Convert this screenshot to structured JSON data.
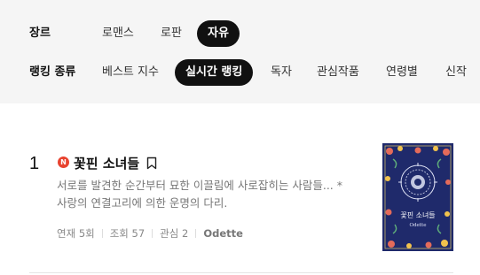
{
  "filters": {
    "genre_label": "장르",
    "genre_options": [
      {
        "label": "로맨스",
        "active": false
      },
      {
        "label": "로판",
        "active": false
      },
      {
        "label": "자유",
        "active": true
      }
    ],
    "ranking_label": "랭킹 종류",
    "ranking_options": [
      {
        "label": "베스트 지수",
        "active": false
      },
      {
        "label": "실시간 랭킹",
        "active": true
      },
      {
        "label": "독자",
        "active": false
      },
      {
        "label": "관심작품",
        "active": false
      },
      {
        "label": "연령별",
        "active": false
      },
      {
        "label": "신작",
        "active": false
      }
    ]
  },
  "entries": [
    {
      "rank": "1",
      "badge": "N",
      "title": "꽃핀 소녀들",
      "description_line1": "서로를 발견한 순간부터 묘한 이끌림에 사로잡히는 사람들... *",
      "description_line2": "사랑의 연결고리에 의한 운명의 다리.",
      "meta": {
        "serial": "연재 5회",
        "views": "조회 57",
        "interest": "관심 2",
        "author": "Odette"
      },
      "cover_title": "꽃핀 소녀들",
      "cover_author": "Odette"
    }
  ],
  "colors": {
    "active_chip": "#111111",
    "badge": "#e8432f",
    "cover_bg": "#1f2a6b"
  },
  "icons": {
    "badge": "new-badge-icon",
    "bookmark": "bookmark-icon"
  }
}
